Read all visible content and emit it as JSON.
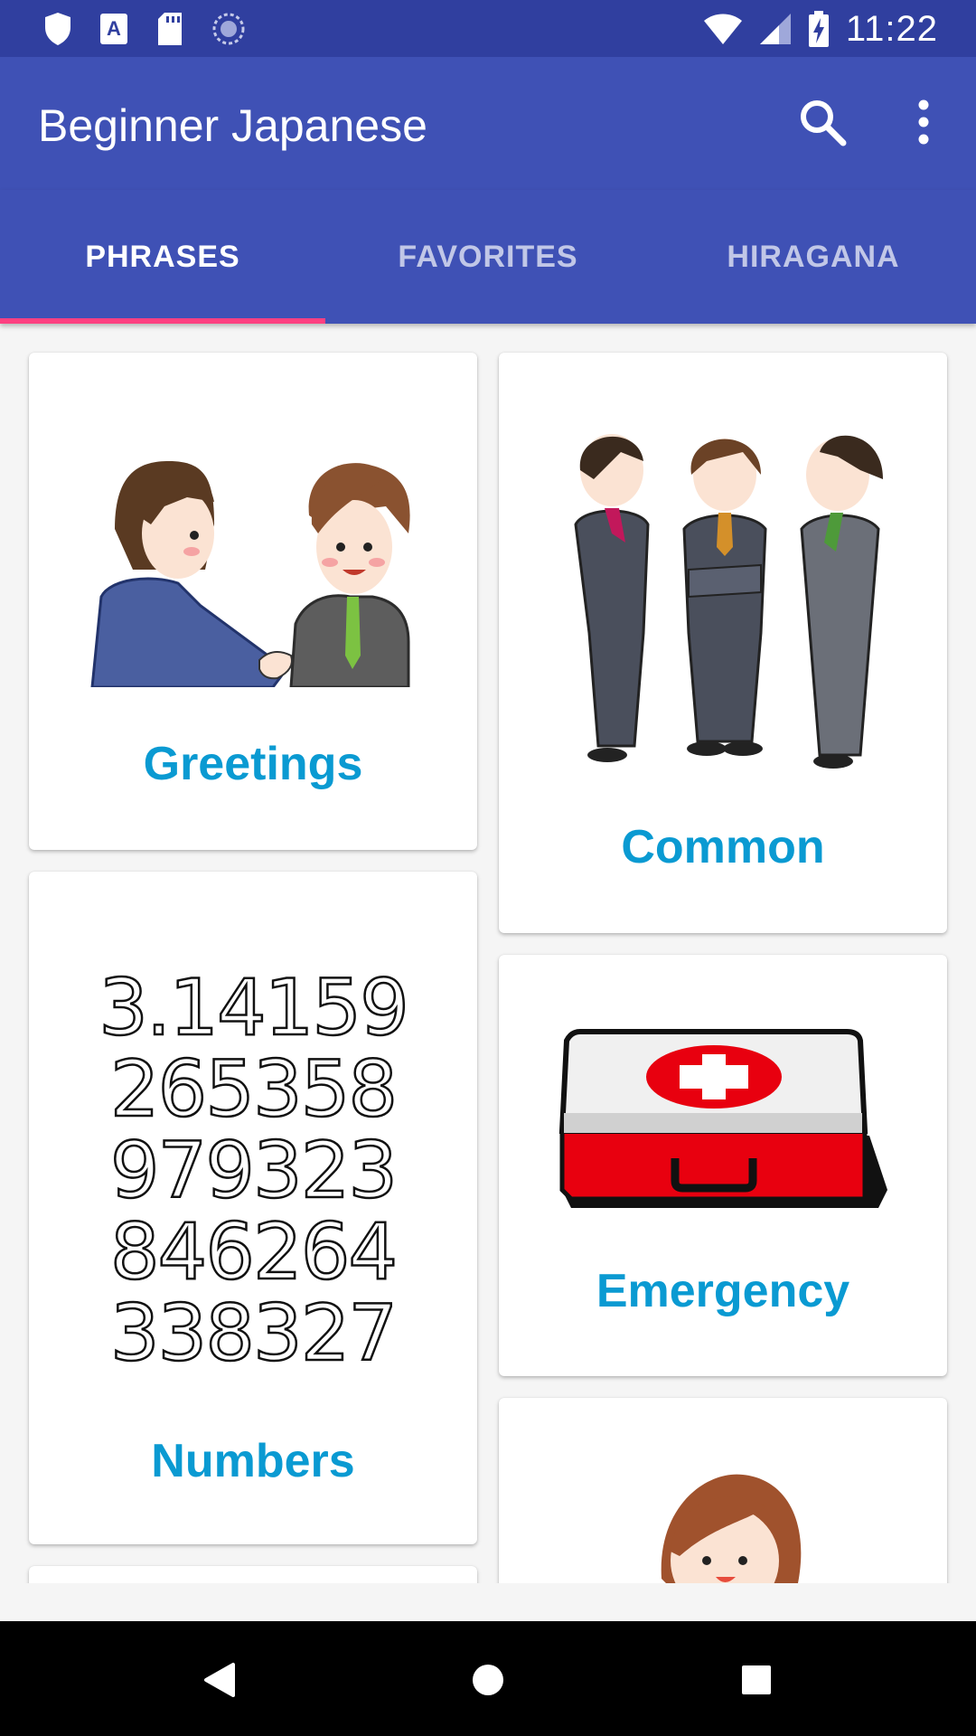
{
  "status_bar": {
    "time": "11:22",
    "icons": [
      "shield-icon",
      "text-a-icon",
      "sd-card-icon",
      "sync-icon",
      "wifi-icon",
      "signal-icon",
      "battery-charging-icon"
    ]
  },
  "app_bar": {
    "title": "Beginner Japanese",
    "icons": [
      "search-icon",
      "more-vert-icon"
    ]
  },
  "tabs": [
    {
      "label": "PHRASES",
      "active": true
    },
    {
      "label": "FAVORITES",
      "active": false
    },
    {
      "label": "HIRAGANA",
      "active": false
    }
  ],
  "cards": {
    "greetings": {
      "label": "Greetings"
    },
    "common": {
      "label": "Common"
    },
    "numbers": {
      "label": "Numbers",
      "digits": [
        "3.14159",
        "265358",
        "979323",
        "846264",
        "338327"
      ]
    },
    "emergency": {
      "label": "Emergency"
    }
  },
  "colors": {
    "status_bar": "#303f9f",
    "primary": "#3f51b5",
    "tab_indicator": "#ff4081",
    "card_label": "#0a9ad2",
    "background": "#f5f5f5"
  },
  "nav_bar": {
    "icons": [
      "back-icon",
      "home-icon",
      "recents-icon"
    ]
  }
}
